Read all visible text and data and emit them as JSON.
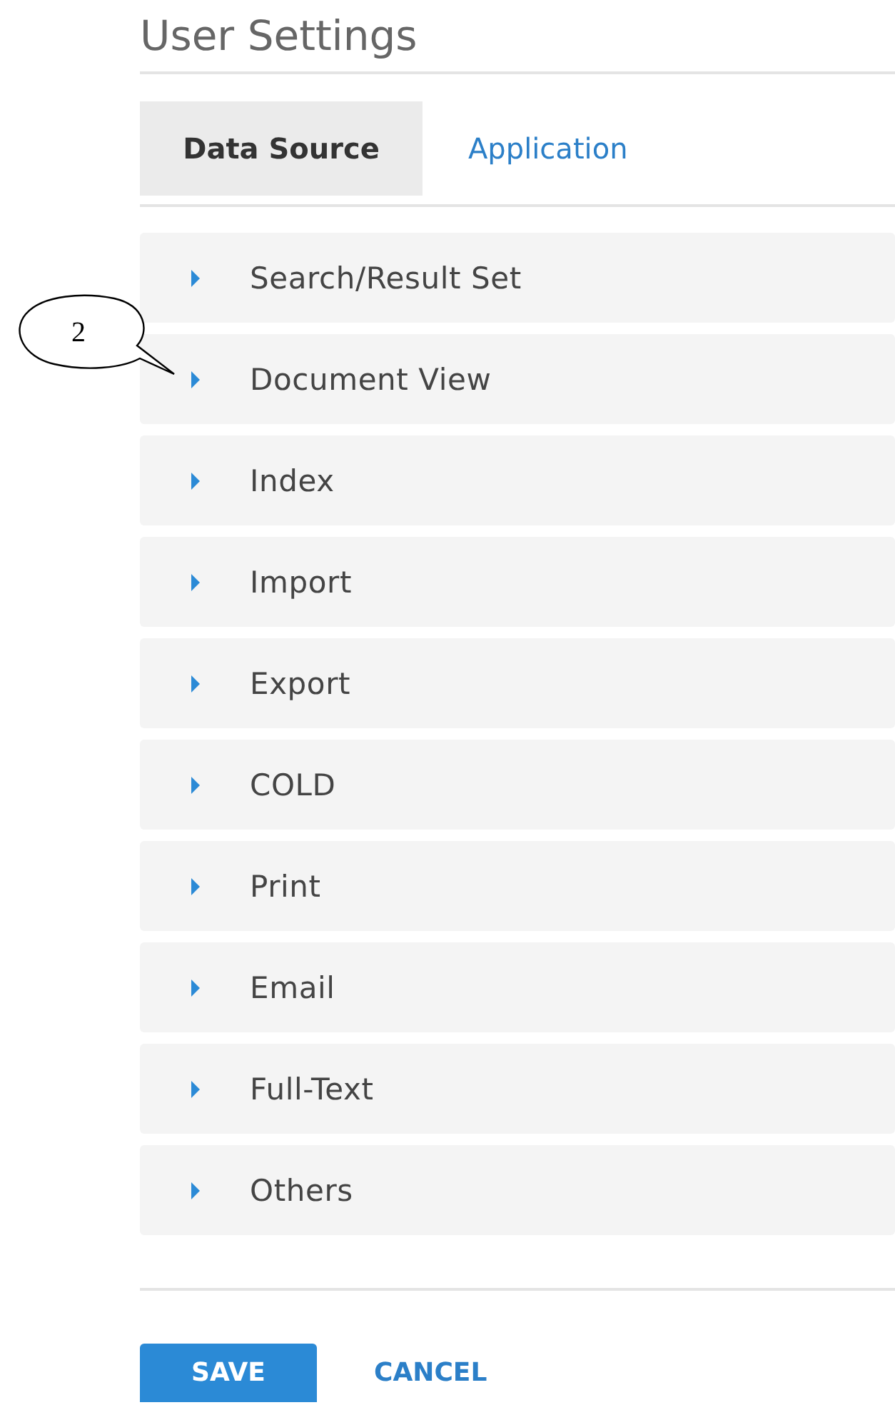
{
  "title": "User Settings",
  "tabs": [
    {
      "label": "Data Source",
      "selected": true
    },
    {
      "label": "Application",
      "selected": false
    }
  ],
  "sections": [
    {
      "label": "Search/Result Set",
      "expanded": false
    },
    {
      "label": "Document View",
      "expanded": false
    },
    {
      "label": "Index",
      "expanded": false
    },
    {
      "label": "Import",
      "expanded": false
    },
    {
      "label": "Export",
      "expanded": false
    },
    {
      "label": "COLD",
      "expanded": false
    },
    {
      "label": "Print",
      "expanded": false
    },
    {
      "label": "Email",
      "expanded": false
    },
    {
      "label": "Full-Text",
      "expanded": false
    },
    {
      "label": "Others",
      "expanded": false
    }
  ],
  "callout": {
    "label": "2"
  },
  "buttons": [
    {
      "label": "SAVE",
      "kind": "primary"
    },
    {
      "label": "CANCEL",
      "kind": "link"
    }
  ]
}
